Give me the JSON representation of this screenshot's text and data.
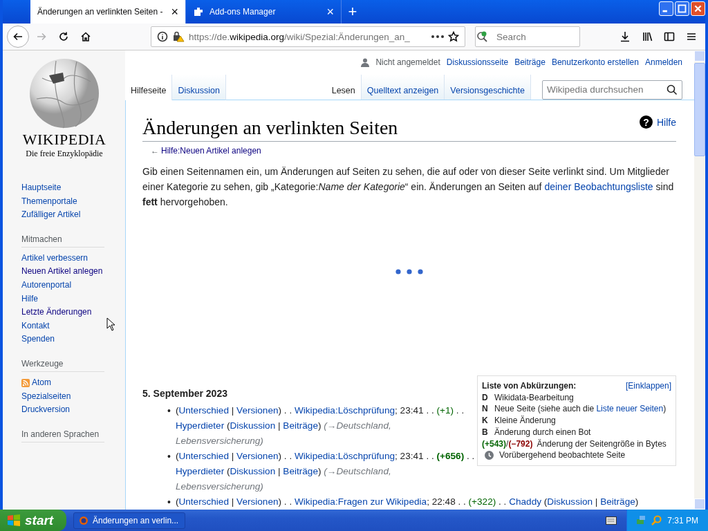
{
  "browser": {
    "tabs": [
      {
        "title": "Änderungen an verlinkten Seiten -",
        "selected": true,
        "close": "×"
      },
      {
        "title": "Add-ons Manager",
        "selected": false,
        "close": "×"
      }
    ],
    "new_tab": "+",
    "forward_disabled": true,
    "url": "https://de.**wikipedia.org**/wiki/Spezial:Änderungen_an_",
    "search": {
      "placeholder": "Search"
    }
  },
  "wiki": {
    "logo": {
      "wordmark": "WIKIPEDIA",
      "tagline": "Die freie Enzyklopädie"
    },
    "sidebar": [
      {
        "items": [
          {
            "label": "Hauptseite",
            "visited": false
          },
          {
            "label": "Themenportale",
            "visited": false
          },
          {
            "label": "Zufälliger Artikel",
            "visited": false
          }
        ]
      },
      {
        "heading": "Mitmachen",
        "items": [
          {
            "label": "Artikel verbessern",
            "visited": false
          },
          {
            "label": "Neuen Artikel anlegen",
            "visited": true
          },
          {
            "label": "Autorenportal",
            "visited": false
          },
          {
            "label": "Hilfe",
            "visited": false
          },
          {
            "label": "Letzte Änderungen",
            "visited": true
          },
          {
            "label": "Kontakt",
            "visited": false
          },
          {
            "label": "Spenden",
            "visited": false
          }
        ]
      },
      {
        "heading": "Werkzeuge",
        "items": [
          {
            "label": "Atom",
            "visited": false,
            "kind": "feed"
          },
          {
            "label": "Spezialseiten",
            "visited": false
          },
          {
            "label": "Druckversion",
            "visited": false
          }
        ]
      },
      {
        "heading": "In anderen Sprachen"
      }
    ],
    "personal": {
      "status": "Nicht angemeldet",
      "links": [
        "Diskussionsseite",
        "Beiträge",
        "Benutzerkonto erstellen",
        "Anmelden"
      ]
    },
    "left_tabs": [
      {
        "label": "Hilfeseite",
        "selected": true
      },
      {
        "label": "Diskussion",
        "selected": false
      }
    ],
    "right_tabs": [
      {
        "label": "Lesen",
        "selected": true
      },
      {
        "label": "Quelltext anzeigen",
        "selected": false
      },
      {
        "label": "Versionsgeschichte",
        "selected": false
      }
    ],
    "search": {
      "placeholder": "Wikipedia durchsuchen"
    },
    "title": "Änderungen an verlinkten Seiten",
    "help": {
      "icon": "?",
      "label": "Hilfe"
    },
    "back_link": {
      "arrow": "←",
      "label": "Hilfe:Neuen Artikel anlegen"
    },
    "intro": [
      {
        "kind": "text",
        "text": "Gib einen Seitennamen ein, um Änderungen auf Seiten zu sehen, die auf oder von dieser Seite verlinkt sind. Um Mitglieder einer Kategorie zu sehen, gib „Kategorie:*Name der Kategorie*“ ein. Änderungen an Seiten auf "
      },
      {
        "kind": "link",
        "text": "deiner Beobachtungsliste"
      },
      {
        "kind": "text",
        "text": " sind **fett** hervorgehoben."
      }
    ],
    "legend": {
      "title": "Liste von Abkürzungen:",
      "toggle": "[Einklappen]",
      "rows": [
        {
          "kind": "letter",
          "key": "D",
          "text": "Wikidata-Bearbeitung"
        },
        {
          "kind": "letter",
          "key": "N",
          "text": "Neue Seite (siehe auch die ",
          "link": "Liste neuer Seiten",
          "text_end": ")"
        },
        {
          "kind": "letter",
          "key": "K",
          "text": "Kleine Änderung"
        },
        {
          "kind": "letter",
          "key": "B",
          "text": "Änderung durch einen Bot"
        },
        {
          "kind": "sizes",
          "plus": "(+543)",
          "sep": "/",
          "minus": "(−792)",
          "text": "Änderung der Seitengröße in Bytes"
        },
        {
          "kind": "clock",
          "text": "Vorübergehend beobachtete Seite"
        }
      ]
    },
    "date": "5. September 2023",
    "bullet": "•",
    "entries": [
      [
        {
          "kind": "text",
          "text": "("
        },
        {
          "kind": "link",
          "text": "Unterschied"
        },
        {
          "kind": "text",
          "text": " | "
        },
        {
          "kind": "link",
          "text": "Versionen"
        },
        {
          "kind": "text",
          "text": ") . . "
        },
        {
          "kind": "link",
          "text": "Wikipedia:Löschprüfung"
        },
        {
          "kind": "text",
          "text": "; 23:41 . . "
        },
        {
          "kind": "diff",
          "text": "(+1)"
        },
        {
          "kind": "text",
          "text": " . . "
        },
        {
          "kind": "link",
          "text": "Hyperdieter"
        },
        {
          "kind": "text",
          "text": " ("
        },
        {
          "kind": "link",
          "text": "Diskussion"
        },
        {
          "kind": "text",
          "text": " | "
        },
        {
          "kind": "link",
          "text": "Beiträge"
        },
        {
          "kind": "text",
          "text": ") "
        },
        {
          "kind": "comment",
          "text": "(→Deutschland, Lebensversicherung)"
        }
      ],
      [
        {
          "kind": "text",
          "text": "("
        },
        {
          "kind": "link",
          "text": "Unterschied"
        },
        {
          "kind": "text",
          "text": " | "
        },
        {
          "kind": "link",
          "text": "Versionen"
        },
        {
          "kind": "text",
          "text": ") . . "
        },
        {
          "kind": "link",
          "text": "Wikipedia:Löschprüfung"
        },
        {
          "kind": "text",
          "text": "; 23:41 . . "
        },
        {
          "kind": "diff_big",
          "text": "(+656)"
        },
        {
          "kind": "text",
          "text": " . . "
        },
        {
          "kind": "link",
          "text": "Hyperdieter"
        },
        {
          "kind": "text",
          "text": " ("
        },
        {
          "kind": "link",
          "text": "Diskussion"
        },
        {
          "kind": "text",
          "text": " | "
        },
        {
          "kind": "link",
          "text": "Beiträge"
        },
        {
          "kind": "text",
          "text": ") "
        },
        {
          "kind": "comment",
          "text": "(→Deutschland, Lebensversicherung)"
        }
      ],
      [
        {
          "kind": "text",
          "text": "("
        },
        {
          "kind": "link",
          "text": "Unterschied"
        },
        {
          "kind": "text",
          "text": " | "
        },
        {
          "kind": "link",
          "text": "Versionen"
        },
        {
          "kind": "text",
          "text": ") . . "
        },
        {
          "kind": "link",
          "text": "Wikipedia:Fragen zur Wikipedia"
        },
        {
          "kind": "text",
          "text": "; 22:48 . . "
        },
        {
          "kind": "diff",
          "text": "(+322)"
        },
        {
          "kind": "text",
          "text": " . . "
        },
        {
          "kind": "link",
          "text": "Chaddy"
        },
        {
          "kind": "text",
          "text": " ("
        },
        {
          "kind": "link",
          "text": "Diskussion"
        },
        {
          "kind": "text",
          "text": " | "
        },
        {
          "kind": "link",
          "text": "Beiträge"
        },
        {
          "kind": "text",
          "text": ")"
        }
      ]
    ]
  },
  "taskbar": {
    "start": "start",
    "tasks": [
      {
        "label": "Änderungen an verlin..."
      }
    ],
    "clock": "7:31 PM"
  }
}
